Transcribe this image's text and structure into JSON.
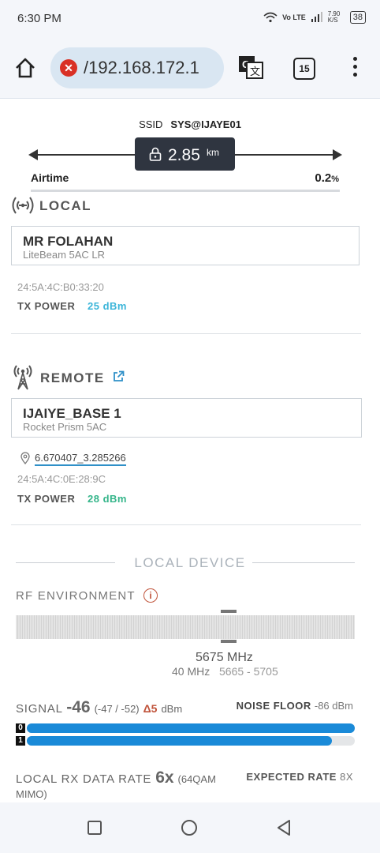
{
  "status_bar": {
    "time": "6:30 PM",
    "network_label": "Vo LTE",
    "speed": "7.90 K/S",
    "battery": "38"
  },
  "browser": {
    "url": "/192.168.172.1",
    "tab_count": "15"
  },
  "link": {
    "ssid_label": "SSID",
    "ssid_value": "SYS@IJAYE01",
    "distance_value": "2.85",
    "distance_unit": "km",
    "airtime_label": "Airtime",
    "airtime_value": "0.2",
    "airtime_unit": "%"
  },
  "local": {
    "heading": "LOCAL",
    "device_name": "MR FOLAHAN",
    "device_model": "LiteBeam 5AC LR",
    "mac": "24:5A:4C:B0:33:20",
    "tx_power_label": "TX POWER",
    "tx_power_value": "25 dBm",
    "tx_power_color": "#3bb5d9"
  },
  "remote": {
    "heading": "REMOTE",
    "device_name": "IJAIYE_BASE 1",
    "device_model": "Rocket Prism 5AC",
    "coordinates": "6.670407_3.285266",
    "mac": "24:5A:4C:0E:28:9C",
    "tx_power_label": "TX POWER",
    "tx_power_value": "28 dBm",
    "tx_power_color": "#35b58a"
  },
  "local_device": {
    "heading": "LOCAL DEVICE",
    "rf_label": "RF ENVIRONMENT",
    "frequency": "5675 MHz",
    "channel_width": "40 MHz",
    "freq_range": "5665 - 5705",
    "signal_label": "SIGNAL",
    "signal_value": "-46",
    "signal_chains": "(-47 / -52)",
    "signal_delta": "Δ5",
    "signal_unit": "dBm",
    "noise_label": "NOISE FLOOR",
    "noise_value": "-86 dBm",
    "chain0_label": "0",
    "chain1_label": "1",
    "chain0_level": 1.0,
    "chain1_level": 0.93,
    "rx_label": "LOCAL RX DATA RATE",
    "rx_value": "6x",
    "rx_detail": "(64QAM MIMO)",
    "expected_label": "EXPECTED RATE",
    "expected_value": "8X"
  }
}
